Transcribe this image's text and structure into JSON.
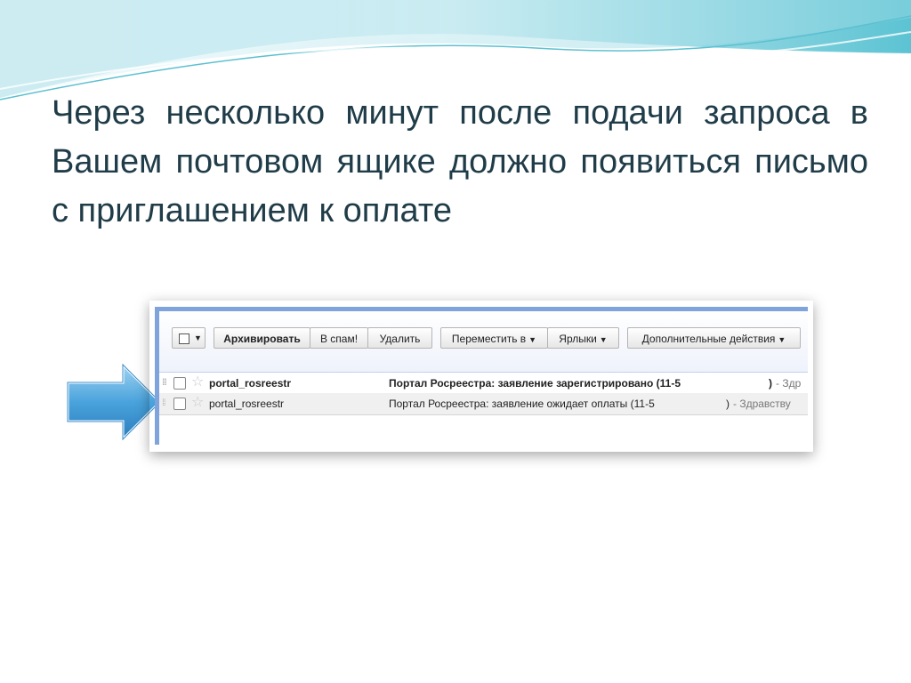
{
  "slide": {
    "text": "Через несколько минут после подачи запроса в Вашем почтовом ящике должно появиться письмо с приглашением к оплате"
  },
  "colors": {
    "wave_light": "#bfe6ee",
    "wave_mid": "#6ccbd9",
    "text": "#1f3c48",
    "arrow": "#4a9fd8",
    "gmail_border": "#7fa3db"
  },
  "toolbar": {
    "select_caret": "▼",
    "archive": "Архивировать",
    "spam": "В спам!",
    "delete": "Удалить",
    "move_to": "Переместить в",
    "labels": "Ярлыки",
    "more_actions": "Дополнительные действия",
    "caret": "▼"
  },
  "emails": [
    {
      "sender": "portal_rosreestr",
      "subject": "Портал Росреестра: заявление зарегистрировано (11-5",
      "paren": ")",
      "snippet": "- Здр",
      "unread": true
    },
    {
      "sender": "portal_rosreestr",
      "subject": "Портал Росреестра: заявление ожидает оплаты (11-5",
      "paren": ")",
      "snippet": "- Здравству",
      "unread": false
    }
  ],
  "icons": {
    "star": "star-icon",
    "arrow": "arrow-right-icon",
    "grip": "drag-handle-icon"
  }
}
